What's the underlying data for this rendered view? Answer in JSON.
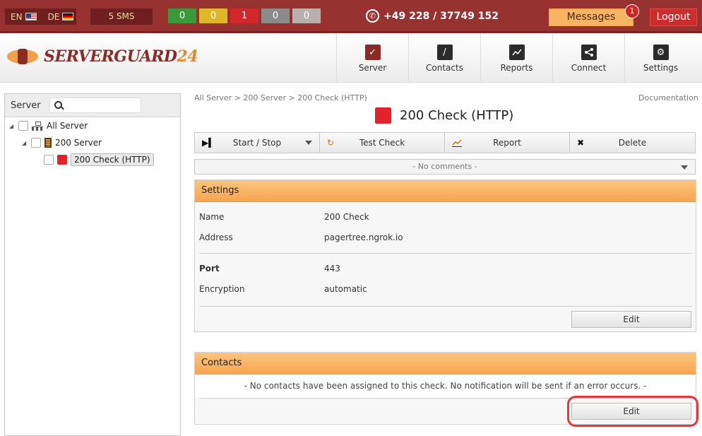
{
  "topbar": {
    "lang_en": "EN",
    "lang_de": "DE",
    "sms": "5 SMS",
    "counters": [
      {
        "value": "0",
        "color": "#3a9a3a"
      },
      {
        "value": "0",
        "color": "#e0b72a"
      },
      {
        "value": "1",
        "color": "#d4272c"
      },
      {
        "value": "0",
        "color": "#8a8a8a"
      },
      {
        "value": "0",
        "color": "#b9b0ad"
      }
    ],
    "phone": "+49 228 / 37749 152",
    "messages_label": "Messages",
    "messages_badge": "1",
    "logout_label": "Logout"
  },
  "header": {
    "logo_main": "SERVERGUARD",
    "logo_num": "24",
    "nav": [
      {
        "label": "Server",
        "icon": "checkmark-icon",
        "color": "#8b2a26"
      },
      {
        "label": "Contacts",
        "icon": "phone-handset-icon",
        "color": "#2b2b2b"
      },
      {
        "label": "Reports",
        "icon": "line-chart-icon",
        "color": "#2b2b2b"
      },
      {
        "label": "Connect",
        "icon": "share-icon",
        "color": "#2b2b2b"
      },
      {
        "label": "Settings",
        "icon": "gear-icon",
        "color": "#2b2b2b"
      }
    ]
  },
  "sidebar": {
    "title": "Server",
    "search_placeholder": "",
    "tree": {
      "root": "All Server",
      "server": "200 Server",
      "check": "200 Check (HTTP)"
    }
  },
  "main": {
    "breadcrumb": "All Server > 200 Server > 200 Check (HTTP)",
    "documentation": "Documentation",
    "title": "200 Check (HTTP)",
    "toolbar": {
      "start_stop": "Start / Stop",
      "test_check": "Test Check",
      "report": "Report",
      "delete": "Delete"
    },
    "comments": "- No comments -",
    "settings": {
      "heading": "Settings",
      "name_label": "Name",
      "name_value": "200 Check",
      "address_label": "Address",
      "address_value": "pagertree.ngrok.io",
      "port_label": "Port",
      "port_value": "443",
      "encryption_label": "Encryption",
      "encryption_value": "automatic",
      "edit_label": "Edit"
    },
    "contacts": {
      "heading": "Contacts",
      "note": "- No contacts have been assigned to this check. No notification will be sent if an error occurs. -",
      "edit_label": "Edit"
    }
  }
}
